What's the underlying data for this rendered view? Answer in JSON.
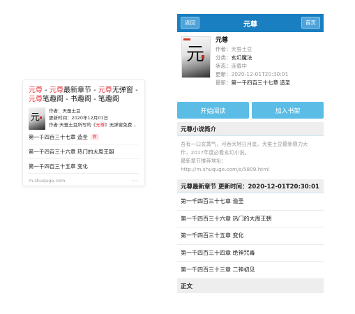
{
  "search_card": {
    "title_parts": [
      "元尊",
      " - ",
      "元尊",
      "最新章节 - ",
      "元尊",
      "无弹窗 - ",
      "元尊",
      "笔趣阁 - 书趣阁 - 笔趣阁"
    ],
    "author": "作者：天蚕土豆",
    "updated": "更新时间：2020年12月01日",
    "desc_prefix": "作者:天蚕土豆所写的《",
    "desc_keyword": "元尊",
    "desc_suffix": "》无弹窗免费...",
    "chapters": [
      {
        "title": "第一千四百三十七章 造圣",
        "badge": "新"
      },
      {
        "title": "第一千四百三十六章 热门的大周王朝"
      },
      {
        "title": "第一千四百三十五章 变化"
      }
    ],
    "source": "m.shuquge.com",
    "more": "···"
  },
  "mobile": {
    "back_label": "返回",
    "title": "元尊",
    "home_label": "首页",
    "book": {
      "name": "元尊",
      "author_label": "作者：",
      "author": "天蚕土豆",
      "category_label": "分类：",
      "category": "玄幻魔法",
      "status_label": "状态：",
      "status": "连载中",
      "updated_label": "更新：",
      "updated": "2020-12-01T20:30:01",
      "latest_label": "最新：",
      "latest": "第一千四百三十七章 造圣"
    },
    "read_label": "开始阅读",
    "shelf_label": "加入书架",
    "intro_head": "元尊小说简介",
    "intro_lines": [
      "吾有一口玄黄气，可吞天地日月星。天蚕土豆最新鼎力大",
      "作，2017年度必看玄幻小说。",
      "最新章节推荐地址：",
      "http://m.shuquge.com/s/5809.html"
    ],
    "latest_head": "元尊最新章节 更新时间：2020-12-01T20:30:01",
    "chapters": [
      "第一千四百三十七章 造圣",
      "第一千四百三十六章 热门的大周王朝",
      "第一千四百三十五章 变化",
      "第一千四百三十四章 绝神咒毒",
      "第一千四百三十三章 二神初见"
    ],
    "body_head": "正文"
  },
  "colors": {
    "brand_blue": "#1a7fc0",
    "button_blue": "#5bbde6",
    "highlight_red": "#e5323d"
  }
}
